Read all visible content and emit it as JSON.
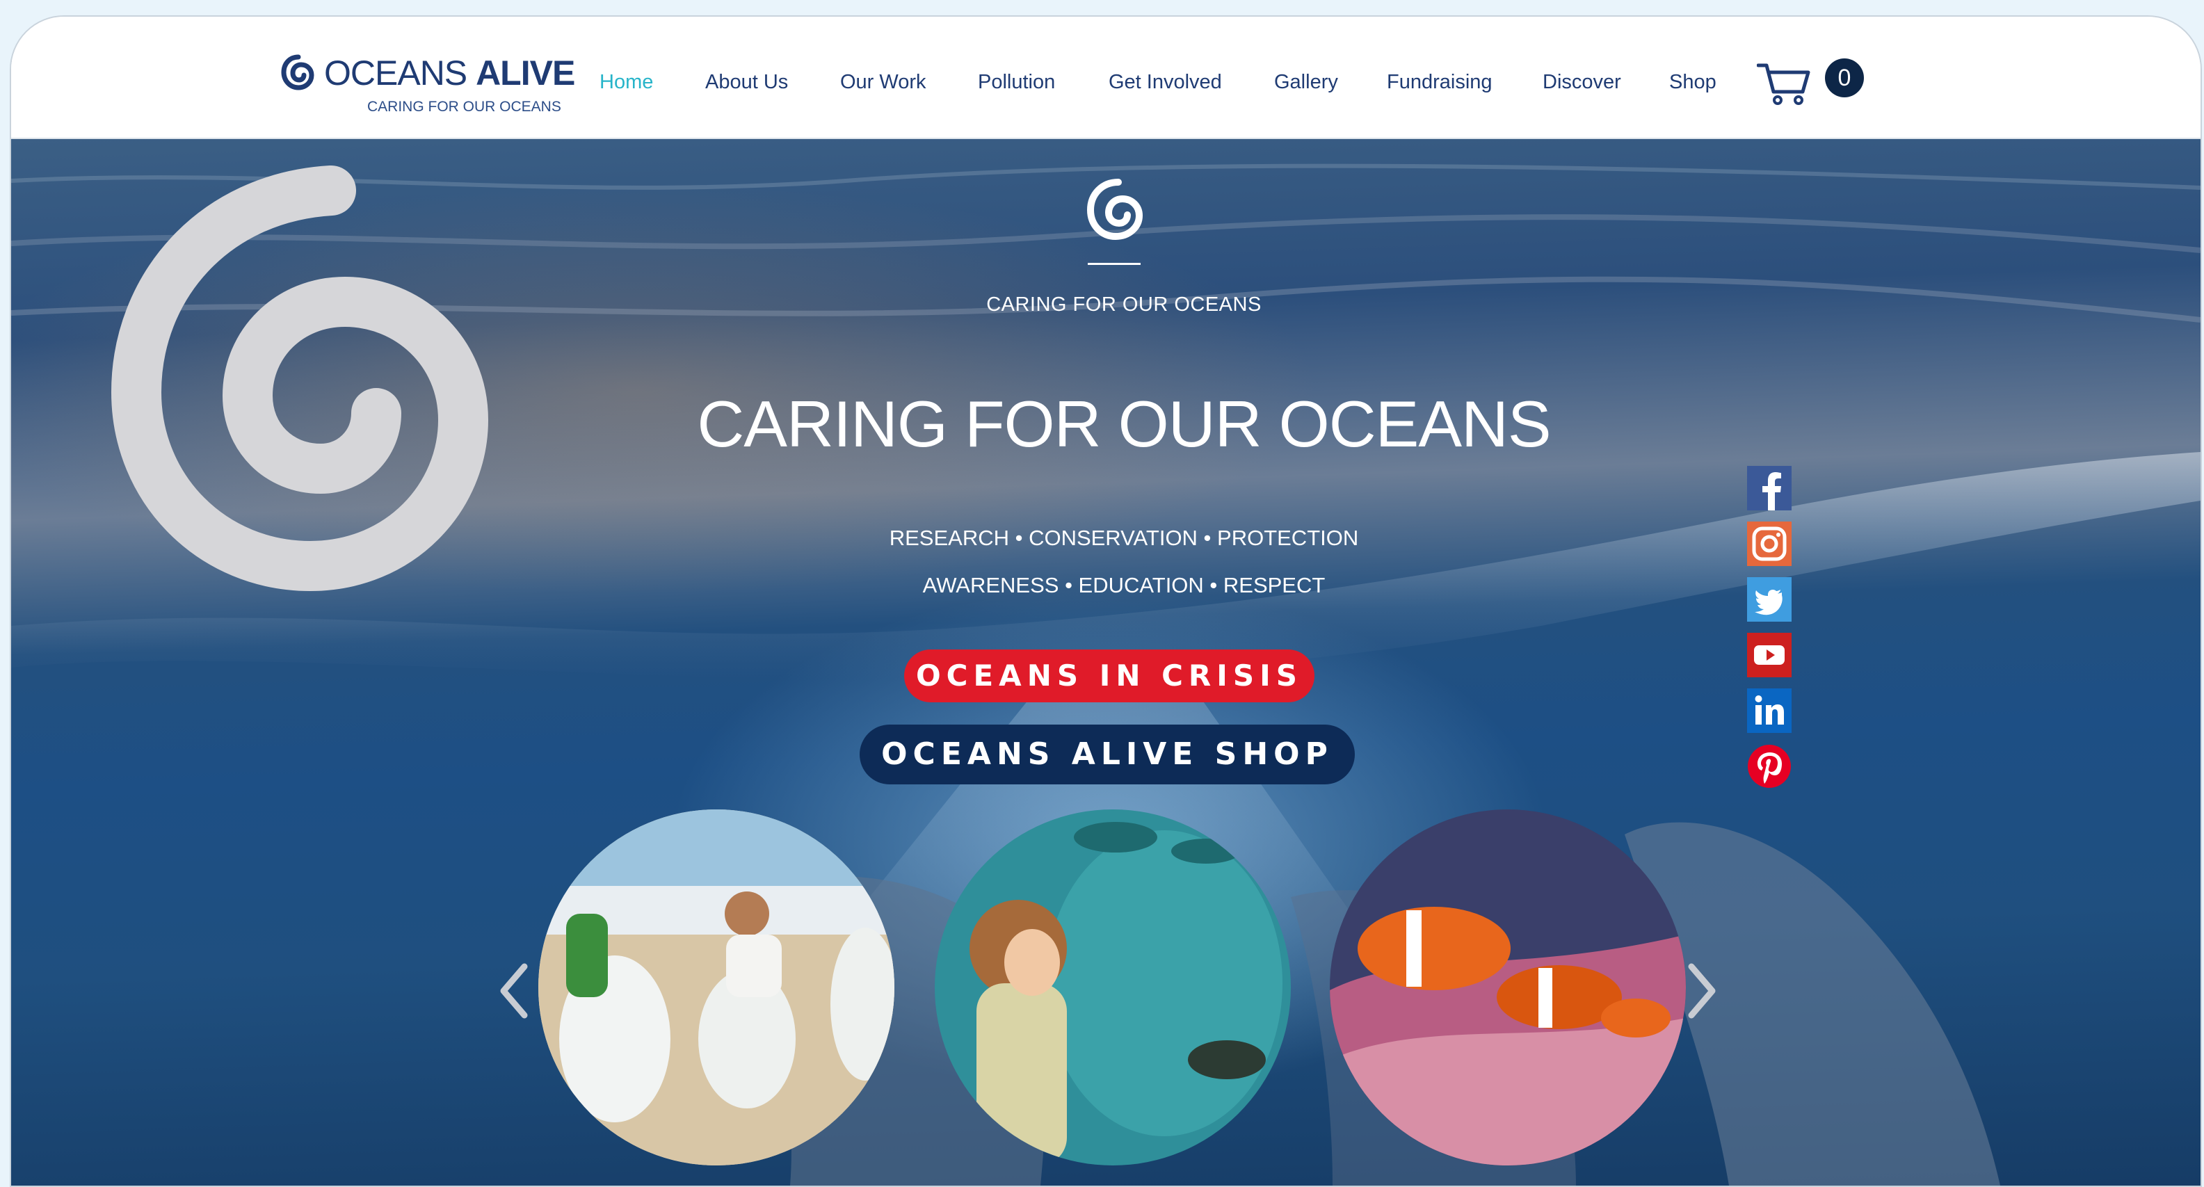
{
  "header": {
    "logo": {
      "name_part1": "OCEANS ",
      "name_part2": "ALIVE",
      "tagline": "CARING FOR OUR OCEANS"
    },
    "nav": [
      {
        "label": "Home",
        "active": true
      },
      {
        "label": "About Us"
      },
      {
        "label": "Our Work"
      },
      {
        "label": "Pollution"
      },
      {
        "label": "Get Involved"
      },
      {
        "label": "Gallery"
      },
      {
        "label": "Fundraising"
      },
      {
        "label": "Discover"
      },
      {
        "label": "Shop"
      }
    ],
    "cart": {
      "icon": "shopping-cart-icon",
      "count": "0"
    }
  },
  "hero": {
    "small_tagline": "CARING FOR OUR OCEANS",
    "title": "CARING FOR OUR OCEANS",
    "line1": "RESEARCH • CONSERVATION • PROTECTION",
    "line2": "AWARENESS • EDUCATION • RESPECT",
    "button_crisis": "OCEANS IN CRISIS",
    "button_shop": "OCEANS ALIVE SHOP",
    "social": [
      "facebook-icon",
      "instagram-icon",
      "twitter-icon",
      "youtube-icon",
      "linkedin-icon",
      "pinterest-icon"
    ],
    "carousel": {
      "prev_icon": "chevron-left-icon",
      "next_icon": "chevron-right-icon",
      "slides": [
        "beach-cleanup-photo",
        "aquarium-child-photo",
        "clownfish-anemone-photo"
      ]
    }
  },
  "colors": {
    "brand_navy": "#1f3b73",
    "nav_active": "#27b4c9",
    "crisis_red": "#e01b29",
    "shop_navy": "#0d2b57"
  }
}
